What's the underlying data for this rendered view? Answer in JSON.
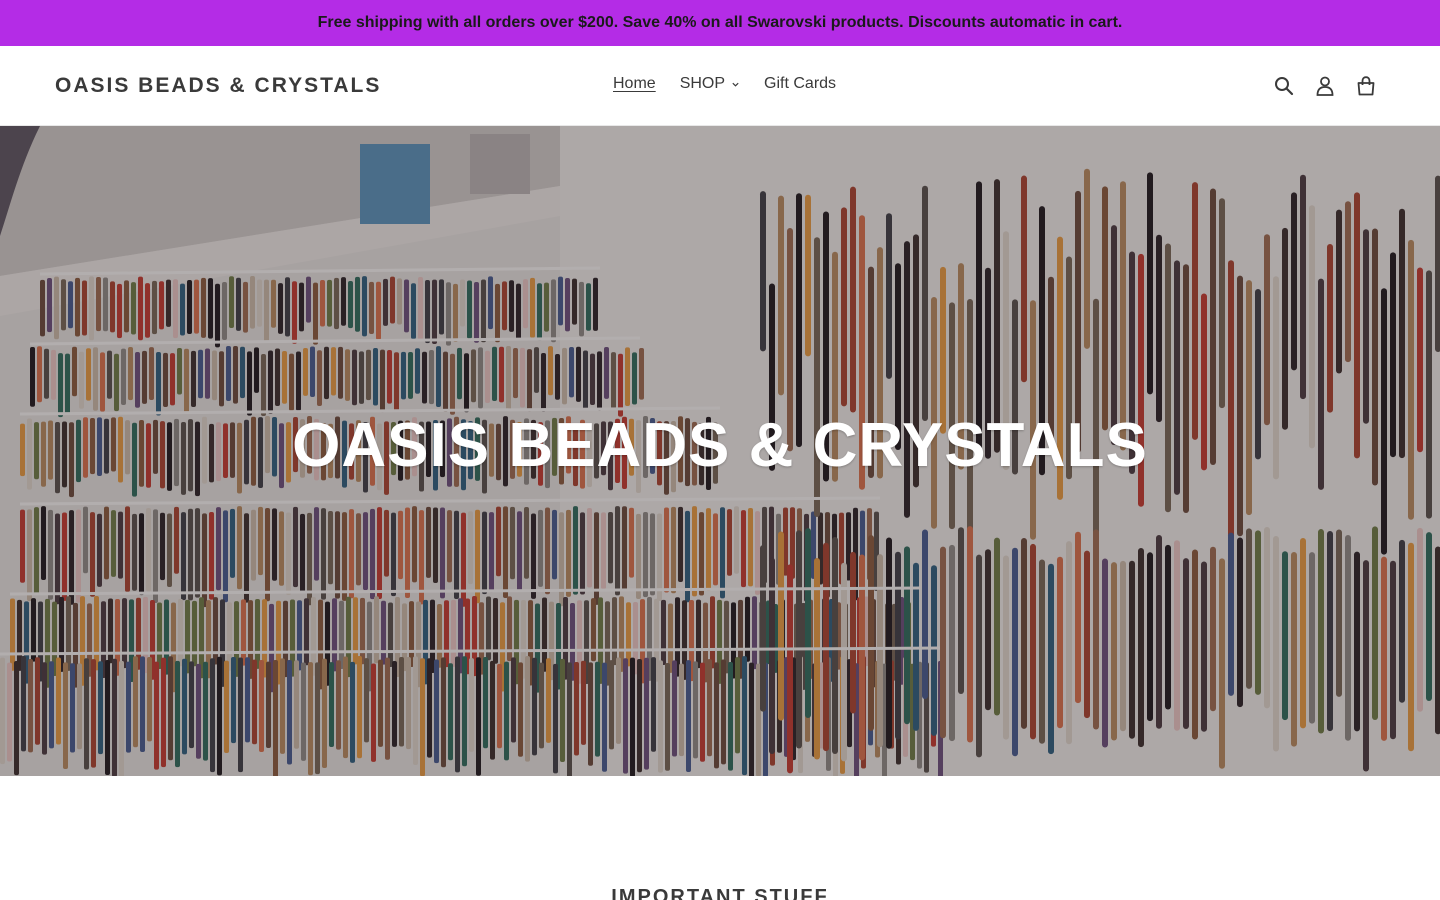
{
  "announcement": {
    "text": "Free shipping with all orders over $200. Save 40% on all Swarovski products. Discounts automatic in cart.",
    "color": "#b42ce6"
  },
  "header": {
    "logo": "OASIS BEADS & CRYSTALS",
    "nav": [
      {
        "label": "Home",
        "active": true
      },
      {
        "label": "SHOP",
        "has_dropdown": true
      },
      {
        "label": "Gift Cards"
      }
    ],
    "icons": [
      "search-icon",
      "account-icon",
      "cart-icon"
    ]
  },
  "hero": {
    "title": "OASIS BEADS & CRYSTALS",
    "image": "bead-store-wall"
  },
  "section": {
    "title": "IMPORTANT STUFF"
  }
}
